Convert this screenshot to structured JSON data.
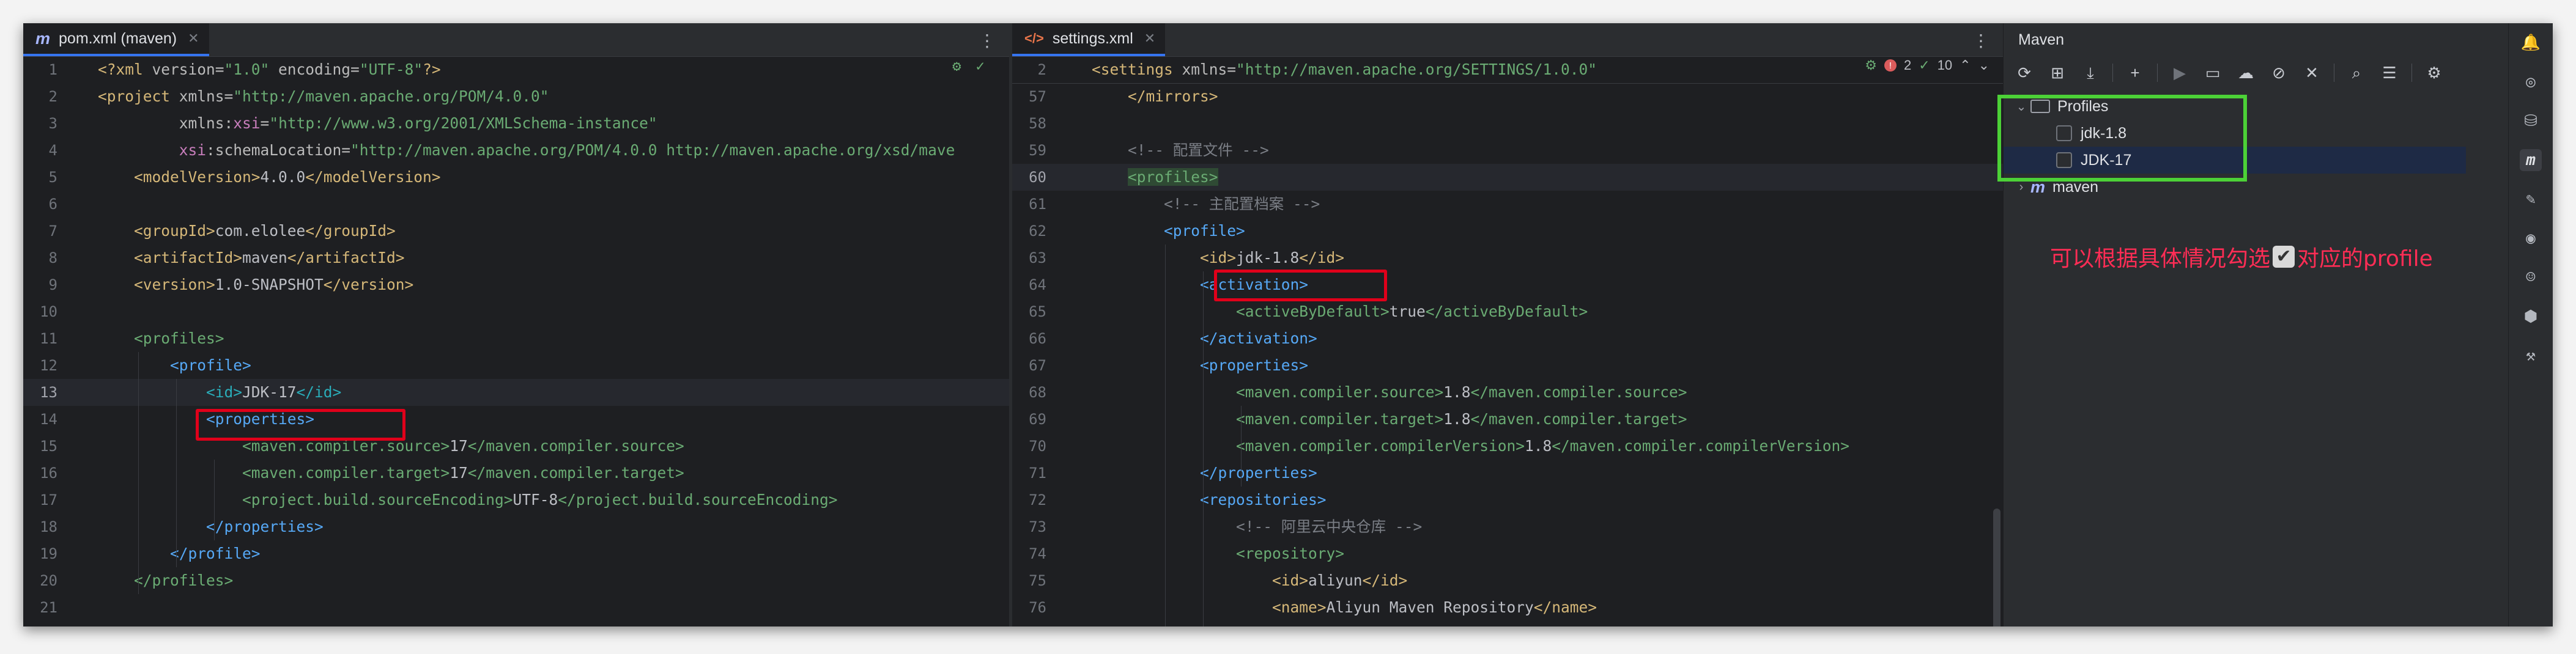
{
  "left_editor": {
    "tab_label": "pom.xml (maven)",
    "tab_icon": "maven-file-icon",
    "current_line": 13,
    "lines": [
      {
        "n": "1",
        "segs": [
          [
            "tag",
            "<?xml "
          ],
          [
            "attr",
            "version="
          ],
          [
            "str",
            "\"1.0\""
          ],
          [
            "attr",
            " encoding="
          ],
          [
            "str",
            "\"UTF-8\""
          ],
          [
            "tag",
            "?>"
          ]
        ]
      },
      {
        "n": "2",
        "segs": [
          [
            "tag",
            "<project "
          ],
          [
            "attr",
            "xmlns="
          ],
          [
            "str",
            "\"http://maven.apache.org/POM/4.0.0\""
          ]
        ]
      },
      {
        "n": "3",
        "segs": [
          [
            "txt",
            "         "
          ],
          [
            "attr",
            "xmlns:"
          ],
          [
            "ns",
            "xsi"
          ],
          [
            "attr",
            "="
          ],
          [
            "str",
            "\"http://www.w3.org/2001/XMLSchema-instance\""
          ]
        ]
      },
      {
        "n": "4",
        "segs": [
          [
            "txt",
            "         "
          ],
          [
            "ns",
            "xsi"
          ],
          [
            "attr",
            ":schemaLocation="
          ],
          [
            "str",
            "\"http://maven.apache.org/POM/4.0.0 http://maven.apache.org/xsd/mave"
          ]
        ]
      },
      {
        "n": "5",
        "segs": [
          [
            "txt",
            "    "
          ],
          [
            "tag",
            "<modelVersion>"
          ],
          [
            "txt",
            "4.0.0"
          ],
          [
            "tag",
            "</modelVersion>"
          ]
        ]
      },
      {
        "n": "6",
        "segs": []
      },
      {
        "n": "7",
        "segs": [
          [
            "txt",
            "    "
          ],
          [
            "tag",
            "<groupId>"
          ],
          [
            "txt",
            "com.elolee"
          ],
          [
            "tag",
            "</groupId>"
          ]
        ]
      },
      {
        "n": "8",
        "segs": [
          [
            "txt",
            "    "
          ],
          [
            "tag",
            "<artifactId>"
          ],
          [
            "txt",
            "maven"
          ],
          [
            "tag",
            "</artifactId>"
          ]
        ]
      },
      {
        "n": "9",
        "segs": [
          [
            "txt",
            "    "
          ],
          [
            "tag",
            "<version>"
          ],
          [
            "txt",
            "1.0-SNAPSHOT"
          ],
          [
            "tag",
            "</version>"
          ]
        ]
      },
      {
        "n": "10",
        "segs": []
      },
      {
        "n": "11",
        "segs": [
          [
            "txt",
            "    "
          ],
          [
            "t-green",
            "<profiles>"
          ]
        ]
      },
      {
        "n": "12",
        "segs": [
          [
            "txt",
            "        "
          ],
          [
            "t-blue",
            "<profile>"
          ]
        ]
      },
      {
        "n": "13",
        "segs": [
          [
            "txt",
            "            "
          ],
          [
            "t-teal",
            "<id>"
          ],
          [
            "txt",
            "JDK-17"
          ],
          [
            "t-teal",
            "</id>"
          ]
        ]
      },
      {
        "n": "14",
        "segs": [
          [
            "txt",
            "            "
          ],
          [
            "tag2",
            "<properties>"
          ]
        ]
      },
      {
        "n": "15",
        "segs": [
          [
            "txt",
            "                "
          ],
          [
            "t-green",
            "<maven.compiler.source>"
          ],
          [
            "txt",
            "17"
          ],
          [
            "t-green",
            "</maven.compiler.source>"
          ]
        ]
      },
      {
        "n": "16",
        "segs": [
          [
            "txt",
            "                "
          ],
          [
            "t-green",
            "<maven.compiler.target>"
          ],
          [
            "txt",
            "17"
          ],
          [
            "t-green",
            "</maven.compiler.target>"
          ]
        ]
      },
      {
        "n": "17",
        "segs": [
          [
            "txt",
            "                "
          ],
          [
            "t-green",
            "<project.build.sourceEncoding>"
          ],
          [
            "txt",
            "UTF-8"
          ],
          [
            "t-green",
            "</project.build.sourceEncoding>"
          ]
        ]
      },
      {
        "n": "18",
        "segs": [
          [
            "txt",
            "            "
          ],
          [
            "tag2",
            "</properties>"
          ]
        ]
      },
      {
        "n": "19",
        "segs": [
          [
            "txt",
            "        "
          ],
          [
            "t-blue",
            "</profile>"
          ]
        ]
      },
      {
        "n": "20",
        "segs": [
          [
            "txt",
            "    "
          ],
          [
            "t-green",
            "</profiles>"
          ]
        ]
      },
      {
        "n": "21",
        "segs": []
      }
    ]
  },
  "right_editor": {
    "tab_label": "settings.xml",
    "tab_icon": "xml-file-icon",
    "sticky_line": {
      "n": "2",
      "segs": [
        [
          "tag",
          "<settings "
        ],
        [
          "attr",
          "xmlns="
        ],
        [
          "str",
          "\"http://maven.apache.org/SETTINGS/1.0.0\""
        ]
      ]
    },
    "errors": "2",
    "checks": "10",
    "current_line": 60,
    "lines": [
      {
        "n": "57",
        "segs": [
          [
            "txt",
            "    "
          ],
          [
            "tag",
            "</mirrors>"
          ]
        ]
      },
      {
        "n": "58",
        "segs": []
      },
      {
        "n": "59",
        "segs": [
          [
            "txt",
            "    "
          ],
          [
            "cmt",
            "<!-- 配置文件 -->"
          ]
        ]
      },
      {
        "n": "60",
        "segs": [
          [
            "txt",
            "    "
          ],
          [
            "t-green",
            "<profiles>"
          ]
        ]
      },
      {
        "n": "61",
        "segs": [
          [
            "txt",
            "        "
          ],
          [
            "cmt",
            "<!-- 主配置档案 -->"
          ]
        ]
      },
      {
        "n": "62",
        "segs": [
          [
            "txt",
            "        "
          ],
          [
            "t-blue",
            "<profile>"
          ]
        ]
      },
      {
        "n": "63",
        "segs": [
          [
            "txt",
            "            "
          ],
          [
            "tag",
            "<id>"
          ],
          [
            "txt",
            "jdk-1.8"
          ],
          [
            "tag",
            "</id>"
          ]
        ]
      },
      {
        "n": "64",
        "segs": [
          [
            "txt",
            "            "
          ],
          [
            "tag2",
            "<activation>"
          ]
        ]
      },
      {
        "n": "65",
        "segs": [
          [
            "txt",
            "                "
          ],
          [
            "t-green",
            "<activeByDefault>"
          ],
          [
            "txt",
            "true"
          ],
          [
            "t-green",
            "</activeByDefault>"
          ]
        ]
      },
      {
        "n": "66",
        "segs": [
          [
            "txt",
            "            "
          ],
          [
            "tag2",
            "</activation>"
          ]
        ]
      },
      {
        "n": "67",
        "segs": [
          [
            "txt",
            "            "
          ],
          [
            "tag2",
            "<properties>"
          ]
        ]
      },
      {
        "n": "68",
        "segs": [
          [
            "txt",
            "                "
          ],
          [
            "t-green",
            "<maven.compiler.source>"
          ],
          [
            "txt",
            "1.8"
          ],
          [
            "t-green",
            "</maven.compiler.source>"
          ]
        ]
      },
      {
        "n": "69",
        "segs": [
          [
            "txt",
            "                "
          ],
          [
            "t-green",
            "<maven.compiler.target>"
          ],
          [
            "txt",
            "1.8"
          ],
          [
            "t-green",
            "</maven.compiler.target>"
          ]
        ]
      },
      {
        "n": "70",
        "segs": [
          [
            "txt",
            "                "
          ],
          [
            "t-green",
            "<maven.compiler.compilerVersion>"
          ],
          [
            "txt",
            "1.8"
          ],
          [
            "t-green",
            "</maven.compiler.compilerVersion>"
          ]
        ]
      },
      {
        "n": "71",
        "segs": [
          [
            "txt",
            "            "
          ],
          [
            "tag2",
            "</properties>"
          ]
        ]
      },
      {
        "n": "72",
        "segs": [
          [
            "txt",
            "            "
          ],
          [
            "tag2",
            "<repositories>"
          ]
        ]
      },
      {
        "n": "73",
        "segs": [
          [
            "txt",
            "                "
          ],
          [
            "cmt",
            "<!-- 阿里云中央仓库 -->"
          ]
        ]
      },
      {
        "n": "74",
        "segs": [
          [
            "txt",
            "                "
          ],
          [
            "t-green",
            "<repository>"
          ]
        ]
      },
      {
        "n": "75",
        "segs": [
          [
            "txt",
            "                    "
          ],
          [
            "tag",
            "<id>"
          ],
          [
            "txt",
            "aliyun"
          ],
          [
            "tag",
            "</id>"
          ]
        ]
      },
      {
        "n": "76",
        "segs": [
          [
            "txt",
            "                    "
          ],
          [
            "tag",
            "<name>"
          ],
          [
            "txt",
            "Aliyun Maven Repository"
          ],
          [
            "tag",
            "</name>"
          ]
        ]
      }
    ]
  },
  "maven": {
    "title": "Maven",
    "toolbar": [
      {
        "name": "reload-icon",
        "glyph": "⟳"
      },
      {
        "name": "add-folder-icon",
        "glyph": "⊞"
      },
      {
        "name": "download-icon",
        "glyph": "⤓"
      },
      {
        "name": "sep"
      },
      {
        "name": "plus-icon",
        "glyph": "+"
      },
      {
        "name": "sep"
      },
      {
        "name": "run-icon",
        "glyph": "▶",
        "disabled": true
      },
      {
        "name": "execute-goal-icon",
        "glyph": "▭"
      },
      {
        "name": "offline-icon",
        "glyph": "☁"
      },
      {
        "name": "skip-tests-icon",
        "glyph": "⊘"
      },
      {
        "name": "collapse-icon",
        "glyph": "✕"
      },
      {
        "name": "sep"
      },
      {
        "name": "analyze-icon",
        "glyph": "⌕"
      },
      {
        "name": "show-deps-icon",
        "glyph": "☰"
      },
      {
        "name": "sep"
      },
      {
        "name": "settings-icon",
        "glyph": "⚙"
      }
    ],
    "tree": {
      "profiles_label": "Profiles",
      "profiles": [
        "jdk-1.8",
        "JDK-17"
      ],
      "project_label": "maven"
    },
    "annotation": {
      "before": "可以根据具体情况勾选",
      "check_glyph": "✔",
      "after": "对应的profile"
    }
  },
  "stripe": [
    {
      "name": "notifications-icon",
      "glyph": "🔔"
    },
    {
      "name": "ai-assistant-icon",
      "glyph": "◎"
    },
    {
      "name": "database-icon",
      "glyph": "⛁"
    },
    {
      "name": "maven-icon",
      "glyph": "m"
    },
    {
      "name": "gradle-icon",
      "glyph": "✎"
    },
    {
      "name": "copilot-icon",
      "glyph": "◉"
    },
    {
      "name": "smile-icon",
      "glyph": "☺"
    },
    {
      "name": "plugin-icon",
      "glyph": "⬢"
    },
    {
      "name": "endpoints-icon",
      "glyph": "⚒"
    }
  ]
}
